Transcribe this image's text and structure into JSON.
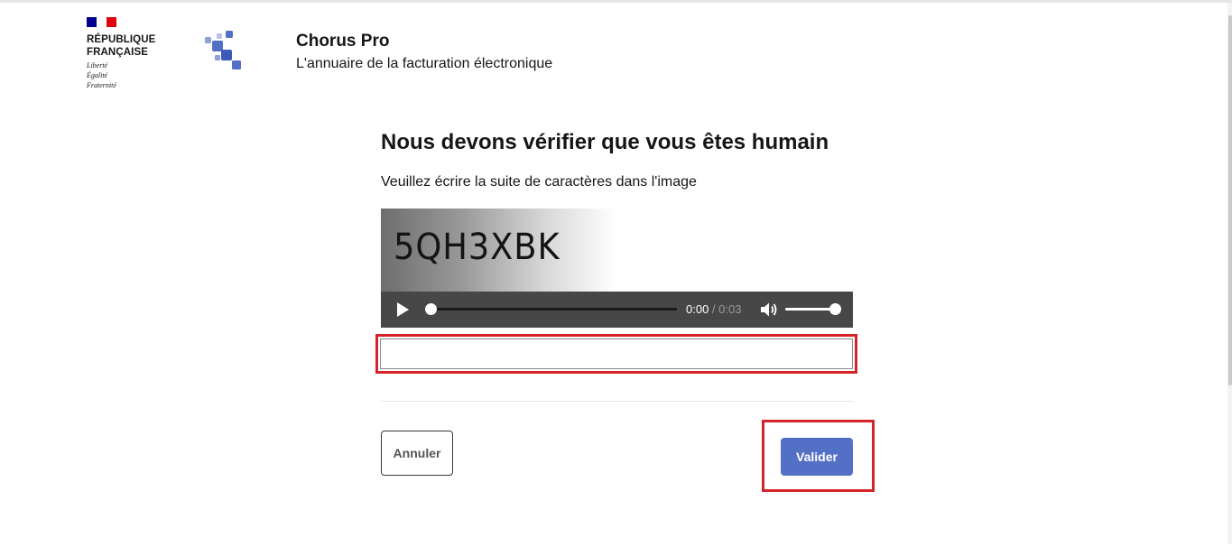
{
  "header": {
    "republique_line1": "RÉPUBLIQUE",
    "republique_line2": "FRANÇAISE",
    "motto": [
      "Liberté",
      "Égalité",
      "Fraternité"
    ],
    "flag_colors": [
      "#000091",
      "#ffffff",
      "#e1000f"
    ],
    "app_logo_icon": "chorus-pro-logo-icon",
    "service_title": "Chorus Pro",
    "service_tagline": "L'annuaire de la facturation électronique"
  },
  "main": {
    "title": "Nous devons vérifier que vous êtes humain",
    "instructions": "Veuillez écrire la suite de caractères dans l'image",
    "captcha_text": "5QH3XBK",
    "audio": {
      "current_time": "0:00",
      "separator": " / ",
      "duration": "0:03",
      "progress": 0,
      "volume": 1
    },
    "input": {
      "value": "",
      "placeholder": ""
    },
    "cancel_label": "Annuler",
    "validate_label": "Valider"
  },
  "colors": {
    "primary": "#5470c6",
    "highlight": "#d4242a",
    "player_bg": "#474747"
  }
}
